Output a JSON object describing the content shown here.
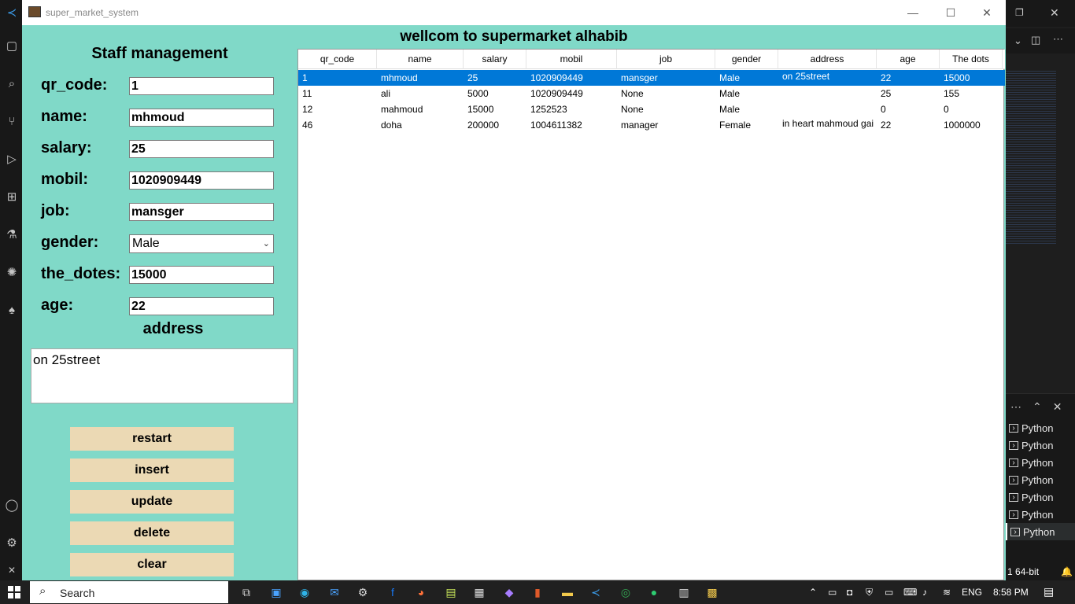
{
  "window": {
    "title": "super_market_system"
  },
  "left_panel": {
    "title": "Staff management",
    "fields": [
      {
        "label": "qr_code:",
        "value": "1"
      },
      {
        "label": "name:",
        "value": "mhmoud"
      },
      {
        "label": "salary:",
        "value": "25"
      },
      {
        "label": "mobil:",
        "value": "1020909449"
      },
      {
        "label": "job:",
        "value": "mansger"
      },
      {
        "label": "gender:",
        "value": "Male"
      },
      {
        "label": "the_dotes:",
        "value": "15000"
      },
      {
        "label": "age:",
        "value": "22"
      }
    ],
    "address_label": "address",
    "address_value": "on 25street",
    "buttons": [
      "restart",
      "insert",
      "update",
      "delete",
      "clear"
    ]
  },
  "header_title": "wellcom to supermarket alhabib",
  "table": {
    "columns": [
      "qr_code",
      "name",
      "salary",
      "mobil",
      "job",
      "gender",
      "address",
      "age",
      "The dots"
    ],
    "rows": [
      [
        "1",
        "mhmoud",
        "25",
        "1020909449",
        "mansger",
        "Male",
        "on 25street",
        "22",
        "15000"
      ],
      [
        "11",
        "ali",
        "5000",
        "1020909449",
        "None",
        "Male",
        "",
        "25",
        "155"
      ],
      [
        "12",
        "mahmoud",
        "15000",
        "1252523",
        "None",
        "Male",
        "",
        "0",
        "0"
      ],
      [
        "46",
        "doha",
        "200000",
        "1004611382",
        "manager",
        "Female",
        "in heart mahmoud gai",
        "22",
        "1000000"
      ]
    ],
    "selected_row": 0
  },
  "vscode": {
    "terminals": [
      "Python",
      "Python",
      "Python",
      "Python",
      "Python",
      "Python",
      "Python"
    ],
    "status": [
      "1",
      "64-bit"
    ]
  },
  "taskbar": {
    "search_placeholder": "Search",
    "language": "ENG",
    "time": "8:58 PM"
  },
  "colors": {
    "window_bg": "#80d9c8",
    "button_bg": "#ebd9b4",
    "selection": "#0078d7"
  }
}
